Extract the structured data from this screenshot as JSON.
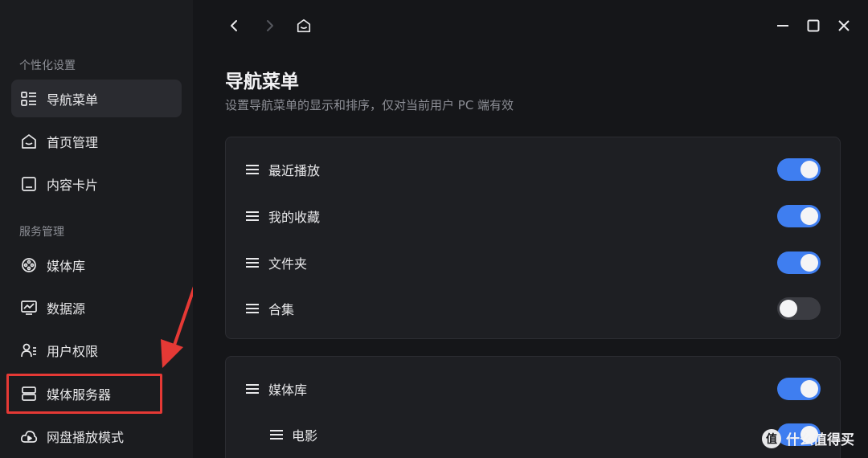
{
  "sidebar": {
    "section_personal": "个性化设置",
    "section_service": "服务管理",
    "items": [
      {
        "label": "导航菜单",
        "icon": "list-layout-icon"
      },
      {
        "label": "首页管理",
        "icon": "home-icon"
      },
      {
        "label": "内容卡片",
        "icon": "card-icon"
      },
      {
        "label": "媒体库",
        "icon": "media-reel-icon"
      },
      {
        "label": "数据源",
        "icon": "monitor-chart-icon"
      },
      {
        "label": "用户权限",
        "icon": "users-icon"
      },
      {
        "label": "媒体服务器",
        "icon": "server-icon"
      },
      {
        "label": "网盘播放模式",
        "icon": "cloud-play-icon"
      }
    ]
  },
  "header": {
    "back_icon": "chevron-left-icon",
    "forward_icon": "chevron-right-icon",
    "home_icon": "home-icon",
    "minimize_icon": "minimize-icon",
    "maximize_icon": "maximize-icon",
    "close_icon": "close-icon"
  },
  "main": {
    "title": "导航菜单",
    "subtitle": "设置导航菜单的显示和排序，仅对当前用户 PC 端有效",
    "group1": [
      {
        "label": "最近播放",
        "on": true
      },
      {
        "label": "我的收藏",
        "on": true
      },
      {
        "label": "文件夹",
        "on": true
      },
      {
        "label": "合集",
        "on": false
      }
    ],
    "group2": [
      {
        "label": "媒体库",
        "on": true
      },
      {
        "label": "电影",
        "on": true
      }
    ]
  },
  "watermark": {
    "icon_text": "值",
    "text": "什么值得买"
  },
  "colors": {
    "accent": "#3f7ef0",
    "highlight": "#e53935",
    "background": "#151619",
    "sidebar": "#1b1c1f"
  }
}
